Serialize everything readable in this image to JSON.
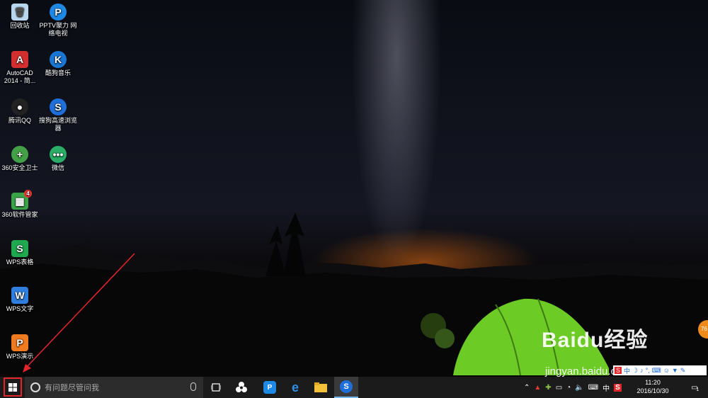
{
  "desktop_icons": [
    {
      "name": "recycle-bin",
      "label": "回收站",
      "color": "#9cc6e8"
    },
    {
      "name": "pptv",
      "label": "PPTV聚力 网络电视",
      "color": "#1e88e5"
    },
    {
      "name": "autocad",
      "label": "AutoCAD 2014 - 简...",
      "color": "#d32f2f"
    },
    {
      "name": "kugou",
      "label": "酷狗音乐",
      "color": "#1976d2"
    },
    {
      "name": "qq",
      "label": "腾讯QQ",
      "color": "#222222"
    },
    {
      "name": "sogou-browser",
      "label": "搜狗高速浏览器",
      "color": "#1e6fd9"
    },
    {
      "name": "360-safe",
      "label": "360安全卫士",
      "color": "#43a047"
    },
    {
      "name": "wechat",
      "label": "微信",
      "color": "#2aae67"
    },
    {
      "name": "360-software",
      "label": "360软件管家",
      "color": "#3aa348",
      "badge": "4"
    },
    {
      "name": "wps-sheets",
      "label": "WPS表格",
      "color": "#1fa84f",
      "letter": "S"
    },
    {
      "name": "wps-writer",
      "label": "WPS文字",
      "color": "#2f7ee0",
      "letter": "W"
    },
    {
      "name": "wps-present",
      "label": "WPS演示",
      "color": "#f07a1f",
      "letter": "P"
    }
  ],
  "taskbar": {
    "search_placeholder": "有问题尽管问我",
    "ime_lang": "中",
    "time": "11:20",
    "date": "2016/10/30",
    "notification_count": "1",
    "pinned": [
      "task-view",
      "fan-app",
      "pptv",
      "edge",
      "file-explorer",
      "sogou-browser"
    ]
  },
  "watermark": {
    "logo": "Baidu经验",
    "url": "jingyan.baidu.com"
  },
  "floating_widget": "76",
  "colors": {
    "taskbar": "#1b1b1b",
    "start_highlight": "#e4262a",
    "arrow": "#e4262a",
    "active_indicator": "#76b9ed"
  }
}
